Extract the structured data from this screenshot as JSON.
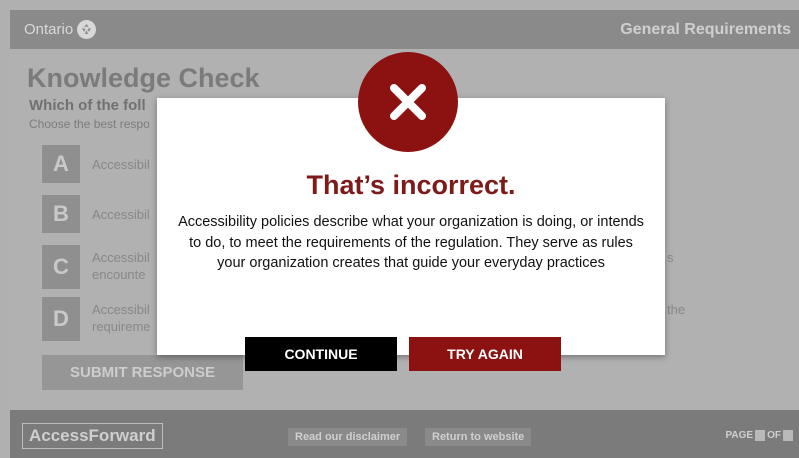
{
  "header": {
    "brand": "Ontario",
    "section_title": "General Requirements"
  },
  "main": {
    "title": "Knowledge Check",
    "question": "Which of the foll",
    "instruction": "Choose the best respo",
    "options": [
      {
        "letter": "A",
        "text": "Accessibil",
        "tail": ""
      },
      {
        "letter": "B",
        "text": "Accessibil",
        "tail": ""
      },
      {
        "letter": "C",
        "text_line1": "Accessibil",
        "text_line2": "encounte",
        "tail": "s"
      },
      {
        "letter": "D",
        "text_line1": "Accessibil",
        "text_line2": "requireme",
        "tail": "the"
      }
    ],
    "submit_label": "SUBMIT RESPONSE"
  },
  "modal": {
    "title": "That’s incorrect.",
    "body": "Accessibility policies describe what your organization is doing, or intends to do, to meet the requirements of the regulation. They serve as rules your organization creates that guide your everyday practices",
    "continue_label": "CONTINUE",
    "try_again_label": "TRY AGAIN",
    "accent_color": "#8c1111"
  },
  "footer": {
    "logo": "AccessForward",
    "disclaimer_link": "Read our disclaimer",
    "return_link": "Return to website",
    "page_label": "PAGE",
    "of_label": "OF"
  }
}
